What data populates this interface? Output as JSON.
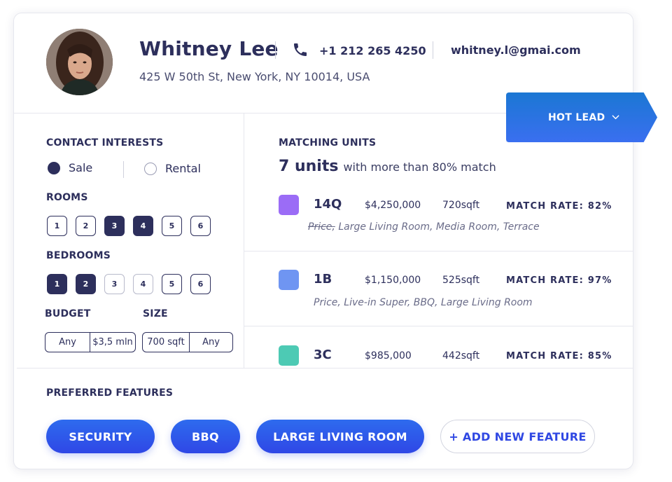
{
  "contact": {
    "name": "Whitney Lee",
    "address": "425 W 50th St, New York, NY 10014, USA",
    "phone": "+1 212 265 4250",
    "email": "whitney.l@gmai.com"
  },
  "lead_status": {
    "label": "HOT LEAD"
  },
  "interests": {
    "title": "CONTACT INTERESTS",
    "options": [
      {
        "label": "Sale",
        "selected": true
      },
      {
        "label": "Rental",
        "selected": false
      }
    ],
    "rooms": {
      "title": "ROOMS",
      "values": [
        "1",
        "2",
        "3",
        "4",
        "5",
        "6"
      ],
      "selected": [
        "3",
        "4"
      ]
    },
    "bedrooms": {
      "title": "BEDROOMS",
      "values": [
        "1",
        "2",
        "3",
        "4",
        "5",
        "6"
      ],
      "selected": [
        "1",
        "2"
      ]
    },
    "budget": {
      "title": "BUDGET",
      "min": "Any",
      "max": "$3,5 mln"
    },
    "size": {
      "title": "SIZE",
      "min": "700 sqft",
      "max": "Any"
    }
  },
  "matching": {
    "title": "MATCHING UNITS",
    "count": "7 units",
    "subtitle": "with more than 80% match",
    "match_label": "MATCH RATE:",
    "units": [
      {
        "id": "14Q",
        "price": "$4,250,000",
        "size": "720sqft",
        "rate": "82%",
        "color": "#9b6cf6",
        "struck": "Price,",
        "features": "Large Living Room, Media Room, Terrace"
      },
      {
        "id": "1B",
        "price": "$1,150,000",
        "size": "525sqft",
        "rate": "97%",
        "color": "#6f95f2",
        "struck": "",
        "features": "Price, Live-in Super, BBQ, Large Living Room"
      },
      {
        "id": "3C",
        "price": "$985,000",
        "size": "442sqft",
        "rate": "85%",
        "color": "#4dcab4",
        "struck": "",
        "features": ""
      }
    ]
  },
  "preferred": {
    "title": "PREFERRED FEATURES",
    "features": [
      "SECURITY",
      "BBQ",
      "LARGE LIVING ROOM"
    ],
    "add_label": "+ ADD NEW FEATURE"
  },
  "icons": [
    "phone-icon",
    "chevron-down-icon",
    "avatar"
  ]
}
